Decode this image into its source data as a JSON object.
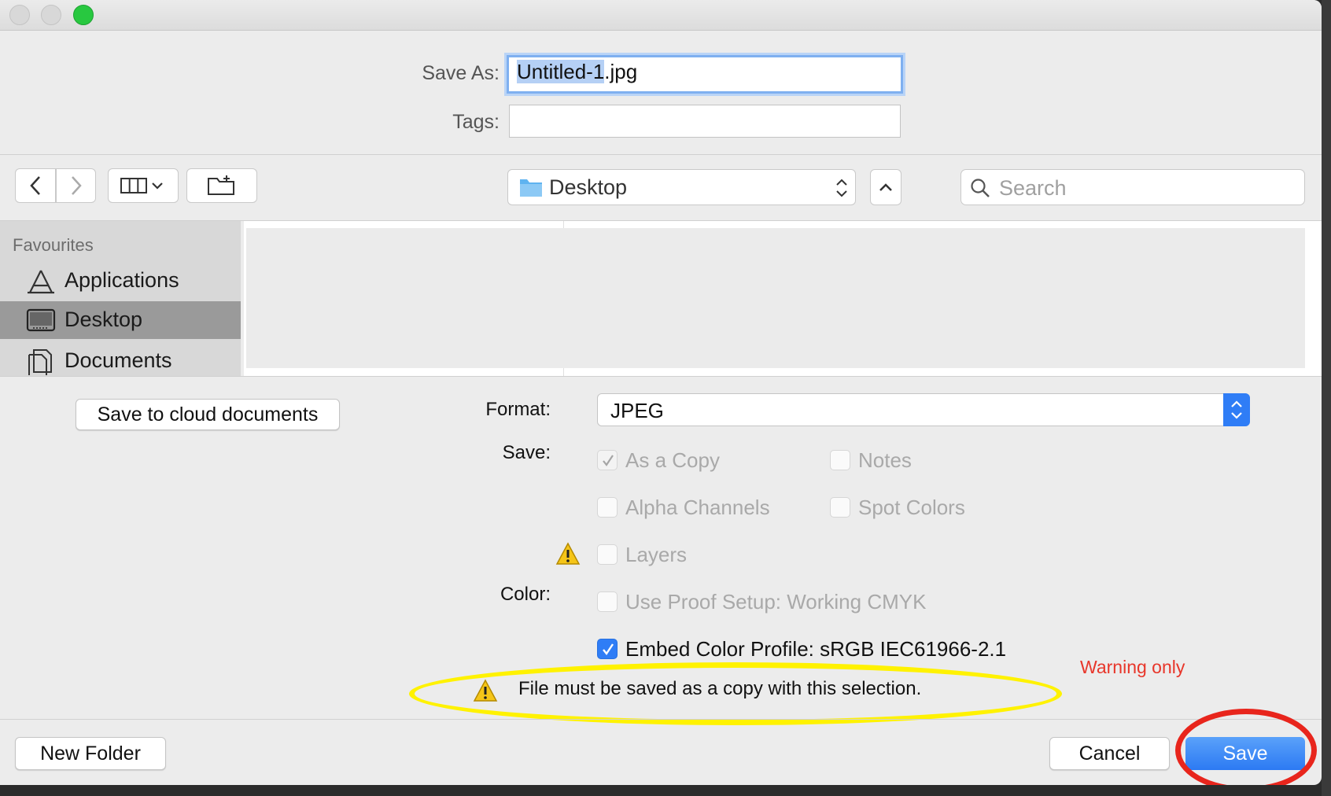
{
  "dialog": {
    "save_as_label": "Save As:",
    "filename_selected": "Untitled-1",
    "filename_ext": ".jpg",
    "tags_label": "Tags:",
    "tags_value": ""
  },
  "toolbar": {
    "location": "Desktop",
    "search_placeholder": "Search"
  },
  "sidebar": {
    "heading": "Favourites",
    "items": [
      {
        "label": "Applications",
        "icon": "applications-icon",
        "selected": false
      },
      {
        "label": "Desktop",
        "icon": "desktop-icon",
        "selected": true
      },
      {
        "label": "Documents",
        "icon": "documents-icon",
        "selected": false
      }
    ]
  },
  "options": {
    "cloud_button": "Save to cloud documents",
    "format_label": "Format:",
    "format_value": "JPEG",
    "save_label": "Save:",
    "color_label": "Color:",
    "checkboxes": {
      "as_a_copy": {
        "label": "As a Copy",
        "checked": true,
        "enabled": false
      },
      "notes": {
        "label": "Notes",
        "checked": false,
        "enabled": false
      },
      "alpha_channels": {
        "label": "Alpha Channels",
        "checked": false,
        "enabled": false
      },
      "spot_colors": {
        "label": "Spot Colors",
        "checked": false,
        "enabled": false
      },
      "layers": {
        "label": "Layers",
        "checked": false,
        "enabled": false
      },
      "use_proof_setup": {
        "label": "Use Proof Setup:  Working CMYK",
        "checked": false,
        "enabled": false
      },
      "embed_color_profile": {
        "label": "Embed Color Profile:  sRGB IEC61966-2.1",
        "checked": true,
        "enabled": true
      }
    },
    "warning": "File must be saved as a copy with this selection."
  },
  "annotation": {
    "note": "Warning only",
    "colors": {
      "highlight": "#fff200",
      "circle": "#e8251c",
      "note": "#e8362a"
    }
  },
  "footer": {
    "new_folder": "New Folder",
    "cancel": "Cancel",
    "save": "Save"
  },
  "colors": {
    "accent": "#2f7df6",
    "window": "#ececec"
  }
}
